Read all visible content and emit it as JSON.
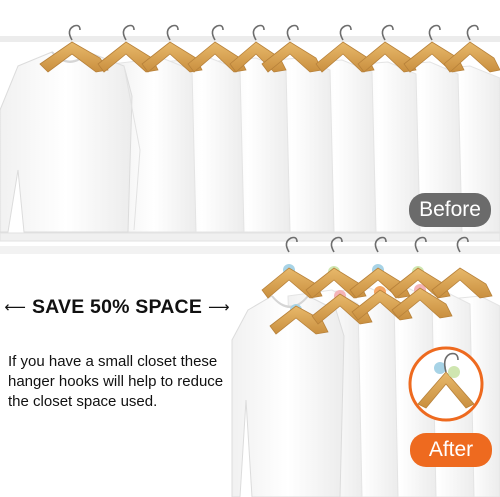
{
  "labels": {
    "before": "Before",
    "after": "After"
  },
  "headline": {
    "text": "SAVE 50% SPACE",
    "arrow_left": "⟵",
    "arrow_right": "⟶"
  },
  "description": "If you have a small closet these hanger hooks will help to reduce the closet space used.",
  "colors": {
    "before_badge": "#6b6b6b",
    "after_badge": "#ee6a1f",
    "hanger_wood": "#d9a55a",
    "hook_metal": "#6d6d6d",
    "rod": "#ececec",
    "hook_blue": "#a7d3e6",
    "hook_green": "#cfe6b0",
    "hook_pink": "#f4b3b8",
    "hook_orange": "#f6a663"
  }
}
